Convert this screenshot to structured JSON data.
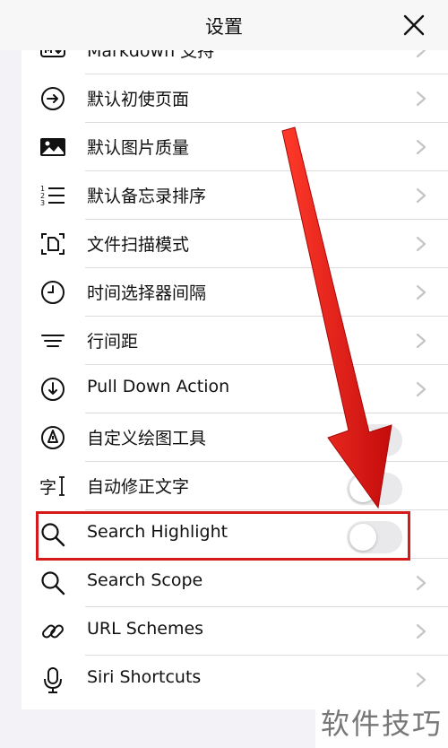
{
  "header": {
    "title": "设置",
    "close_icon": "close-icon"
  },
  "rows": [
    {
      "label": "Markdown 支持",
      "icon": "markdown-icon",
      "control": "chevron"
    },
    {
      "label": "默认初使页面",
      "icon": "arrow-circle-right-icon",
      "control": "chevron"
    },
    {
      "label": "默认图片质量",
      "icon": "image-icon",
      "control": "chevron"
    },
    {
      "label": "默认备忘录排序",
      "icon": "numbered-list-icon",
      "control": "chevron"
    },
    {
      "label": "文件扫描模式",
      "icon": "document-scan-icon",
      "control": "chevron"
    },
    {
      "label": "时间选择器间隔",
      "icon": "clock-icon",
      "control": "chevron"
    },
    {
      "label": "行间距",
      "icon": "line-spacing-icon",
      "control": "chevron"
    },
    {
      "label": "Pull Down Action",
      "icon": "arrow-circle-down-icon",
      "control": "chevron"
    },
    {
      "label": "自定义绘图工具",
      "icon": "pen-nib-icon",
      "control": "toggle",
      "on": false
    },
    {
      "label": "自动修正文字",
      "icon": "text-cursor-icon",
      "control": "toggle",
      "on": false
    },
    {
      "label": "Search Highlight",
      "icon": "search-icon",
      "control": "toggle",
      "on": false
    },
    {
      "label": "Search Scope",
      "icon": "search-icon",
      "control": "chevron"
    },
    {
      "label": "URL Schemes",
      "icon": "link-icon",
      "control": "chevron"
    },
    {
      "label": "Siri Shortcuts",
      "icon": "microphone-icon",
      "control": "chevron"
    }
  ],
  "annotation": {
    "color": "#d51a1a",
    "highlighted_row": "Search Highlight"
  },
  "watermark": {
    "text": "软件技巧"
  }
}
